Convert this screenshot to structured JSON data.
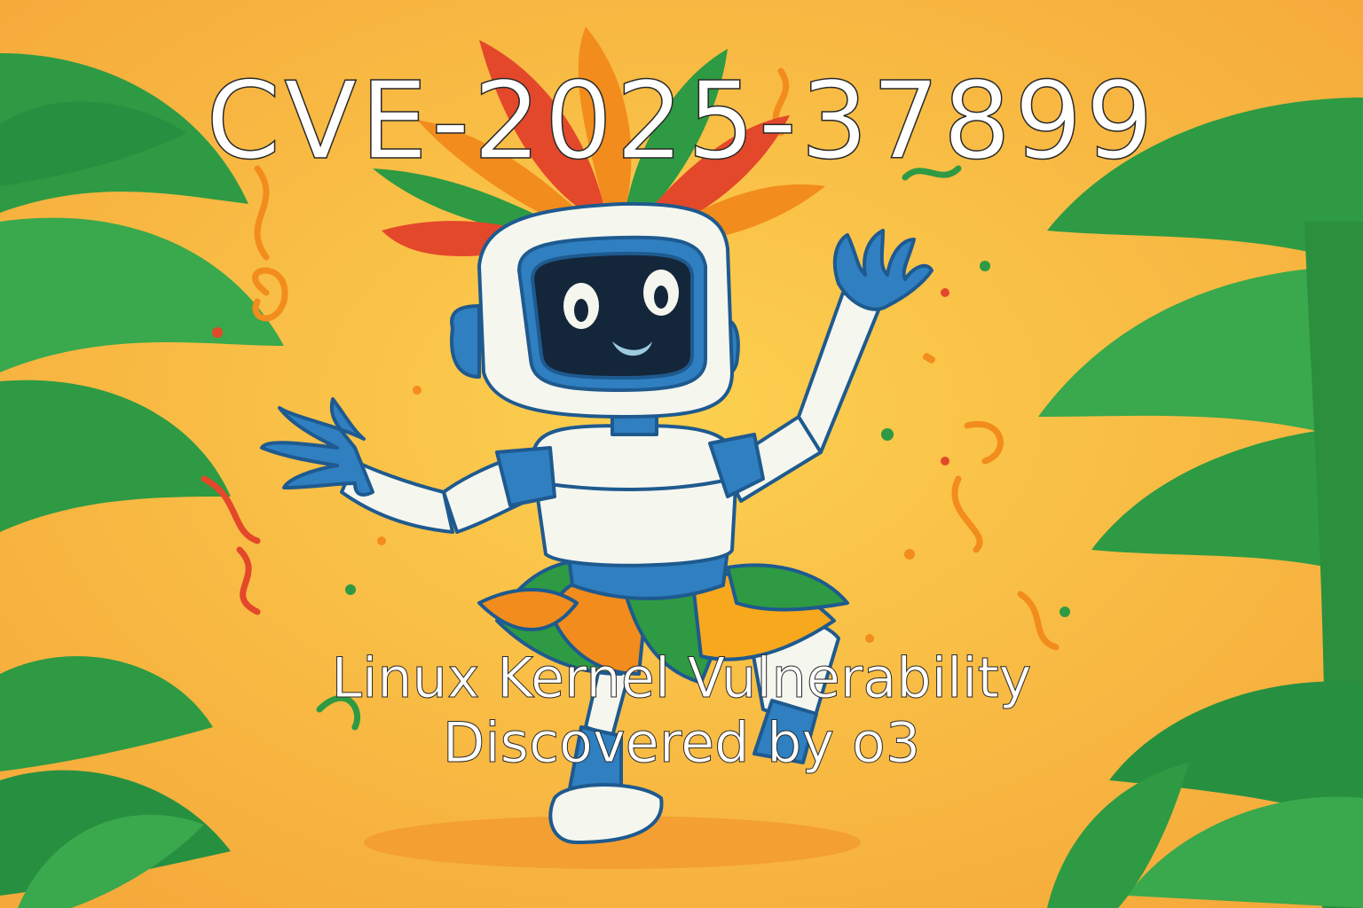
{
  "title": "CVE-2025-37899",
  "subtitle": {
    "line1": "Linux Kernel Vulnerability",
    "line2": "Discovered by o3"
  },
  "colors": {
    "background": "#f7b43c",
    "leaf_green": "#2e9a43",
    "feather_red": "#e3482a",
    "feather_orange": "#f28c1c",
    "robot_blue": "#2f7fc1",
    "robot_white": "#f5f6ee",
    "screen": "#14263a"
  },
  "illustration": {
    "subject": "robot-mascot",
    "elements": [
      "palm-leaves",
      "feather-headdress",
      "feather-skirt",
      "confetti"
    ]
  }
}
